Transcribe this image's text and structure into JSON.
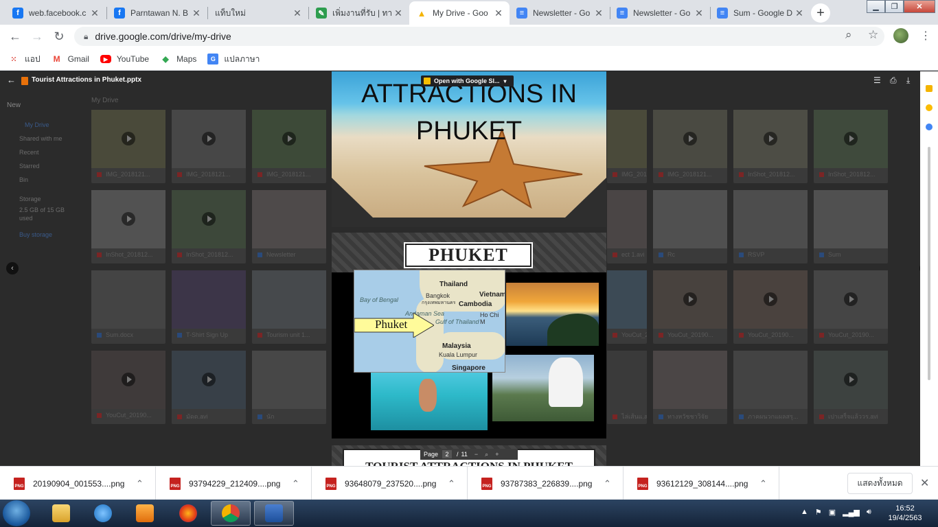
{
  "tabs": [
    {
      "title": "web.facebook.c",
      "icon": "facebook-icon",
      "color": "#1877f2",
      "glyph": "f"
    },
    {
      "title": "Parntawan N. B",
      "icon": "facebook-icon",
      "color": "#1877f2",
      "glyph": "f"
    },
    {
      "title": "แท็บใหม่",
      "icon": "",
      "color": "",
      "glyph": ""
    },
    {
      "title": "เพิ่มงานที่รับ | ทา",
      "icon": "classroom-icon",
      "color": "#2e9d4f",
      "glyph": "✎"
    },
    {
      "title": "My Drive - Goo",
      "icon": "drive-icon",
      "color": "#f4b400",
      "glyph": "▲"
    },
    {
      "title": "Newsletter - Go",
      "icon": "docs-icon",
      "color": "#4285f4",
      "glyph": "≡"
    },
    {
      "title": "Newsletter - Go",
      "icon": "docs-icon",
      "color": "#4285f4",
      "glyph": "≡"
    },
    {
      "title": "Sum - Google D",
      "icon": "docs-icon",
      "color": "#4285f4",
      "glyph": "≡"
    }
  ],
  "address": {
    "url": "drive.google.com/drive/my-drive"
  },
  "bookmarks": [
    {
      "label": "แอป",
      "icon": "apps-grid-icon"
    },
    {
      "label": "Gmail",
      "icon": "gmail-icon"
    },
    {
      "label": "YouTube",
      "icon": "youtube-icon"
    },
    {
      "label": "Maps",
      "icon": "maps-icon"
    },
    {
      "label": "แปลภาษา",
      "icon": "translate-icon"
    }
  ],
  "viewer": {
    "file_title": "Tourist Attractions in Phuket.pptx",
    "open_with": "Open with Google Sl...",
    "page_label": "Page",
    "page_current": "2",
    "page_sep": "/",
    "page_total": "11"
  },
  "drive_sidebar": {
    "new": "New",
    "items": [
      "My Drive",
      "Shared with me",
      "Recent",
      "Starred",
      "Bin",
      "Storage"
    ],
    "storage_used": "2.5 GB of 15 GB used",
    "buy": "Buy storage",
    "breadcrumb": "My Drive"
  },
  "drive_files": {
    "left": [
      [
        "IMG_2018121...",
        "IMG_2018121...",
        "IMG_2018121..."
      ],
      [
        "InShot_201812...",
        "InShot_201812...",
        "Newsletter"
      ],
      [
        "Sum.docx",
        "T-Shirt Sign Up",
        "Tourism unit 1..."
      ],
      [
        "YouCut_20190...",
        "มัดด.avi",
        "นัก"
      ]
    ],
    "right": [
      [
        "IMG_2018121...",
        "IMG_2018121...",
        "InShot_201812...",
        "InShot_201812..."
      ],
      [
        "ect 1.avi",
        "Rc",
        "RSVP",
        "Sum"
      ],
      [
        "YouCut_20190...",
        "YouCut_20190...",
        "YouCut_20190...",
        "YouCut_20190..."
      ],
      [
        "ไล่เส้นแ.avi",
        "ทางหวัชชาวิจัย",
        "ภาคผนวกแผลสรุ...",
        "เปาเสร็จแล้ววร.avi"
      ]
    ]
  },
  "slides": {
    "slide1_title_line1": "ATTRACTIONS IN",
    "slide1_title_line2": "PHUKET",
    "slide2_heading": "PHUKET",
    "map_labels": {
      "thailand": "Thailand",
      "bangkok": "Bangkok",
      "bangkok_th": "กรุงเทพมหานคร",
      "vietnam": "Vietnam",
      "cambodia": "Cambodia",
      "hochiminh": "Ho Chi M",
      "bay": "Bay of Bengal",
      "andaman": "Andaman Sea",
      "gulf": "Gulf of Thailand",
      "malaysia": "Malaysia",
      "kl": "Kuala Lumpur",
      "singapore": "Singapore",
      "phuket": "Phuket"
    },
    "slide3_heading": "TOURIST ATTRACTIONS IN PHUKET"
  },
  "downloads": [
    {
      "name": "20190904_001553....png"
    },
    {
      "name": "93794229_212409....png"
    },
    {
      "name": "93648079_237520....png"
    },
    {
      "name": "93787383_226839....png"
    },
    {
      "name": "93612129_308144....png"
    }
  ],
  "shelf": {
    "show_all": "แสดงทั้งหมด"
  },
  "taskbar": {
    "time": "16:52",
    "date": "19/4/2563"
  }
}
